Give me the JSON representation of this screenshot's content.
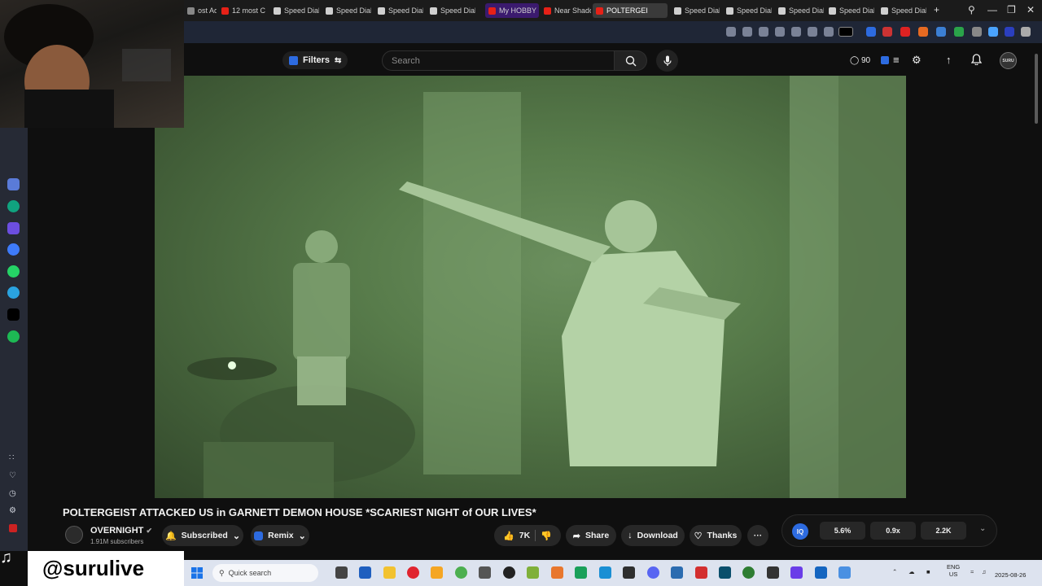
{
  "browser": {
    "tabs": [
      {
        "label": "ost Adve",
        "color": "#888888"
      },
      {
        "label": "12 most C",
        "color": "#e62117"
      },
      {
        "label": "Speed Dial",
        "color": "#cfcfcf"
      },
      {
        "label": "Speed Dial",
        "color": "#cfcfcf"
      },
      {
        "label": "Speed Dial",
        "color": "#cfcfcf"
      },
      {
        "label": "Speed Dial",
        "color": "#cfcfcf"
      },
      {
        "label": "My HOBBY",
        "color": "#e62117"
      },
      {
        "label": "Near Shado",
        "color": "#e62117"
      },
      {
        "label": "POLTERGEI",
        "color": "#e62117"
      },
      {
        "label": "Speed Dial",
        "color": "#cfcfcf"
      },
      {
        "label": "Speed Dial",
        "color": "#cfcfcf"
      },
      {
        "label": "Speed Dial",
        "color": "#cfcfcf"
      },
      {
        "label": "Speed Dial",
        "color": "#cfcfcf"
      },
      {
        "label": "Speed Dial",
        "color": "#cfcfcf"
      }
    ],
    "new_tab": "+"
  },
  "youtube": {
    "filters_label": "Filters",
    "search_placeholder": "Search",
    "notif_count": "90",
    "avatar_text": "SURU"
  },
  "video": {
    "title": "POLTERGEIST ATTACKED US in GARNETT DEMON HOUSE *SCARIEST NIGHT of OUR LIVES*",
    "channel_name": "OVERNIGHT",
    "subscribers": "1.91M subscribers",
    "subscribe_label": "Subscribed",
    "remix_label": "Remix",
    "likes": "7K",
    "share_label": "Share",
    "download_label": "Download",
    "thanks_label": "Thanks",
    "more_label": "···"
  },
  "stats": {
    "badge": "IQ",
    "values": [
      "5.6%",
      "0.9x",
      "2.2K"
    ]
  },
  "overlay": {
    "handle": "@surulive"
  },
  "taskbar": {
    "search_placeholder": "Quick search",
    "lang_top": "ENG",
    "lang_bottom": "US",
    "date": "2025-08-26"
  },
  "colors": {
    "accent_red": "#e62117",
    "video_green": "#587c4b",
    "panel_dark": "#272727"
  }
}
